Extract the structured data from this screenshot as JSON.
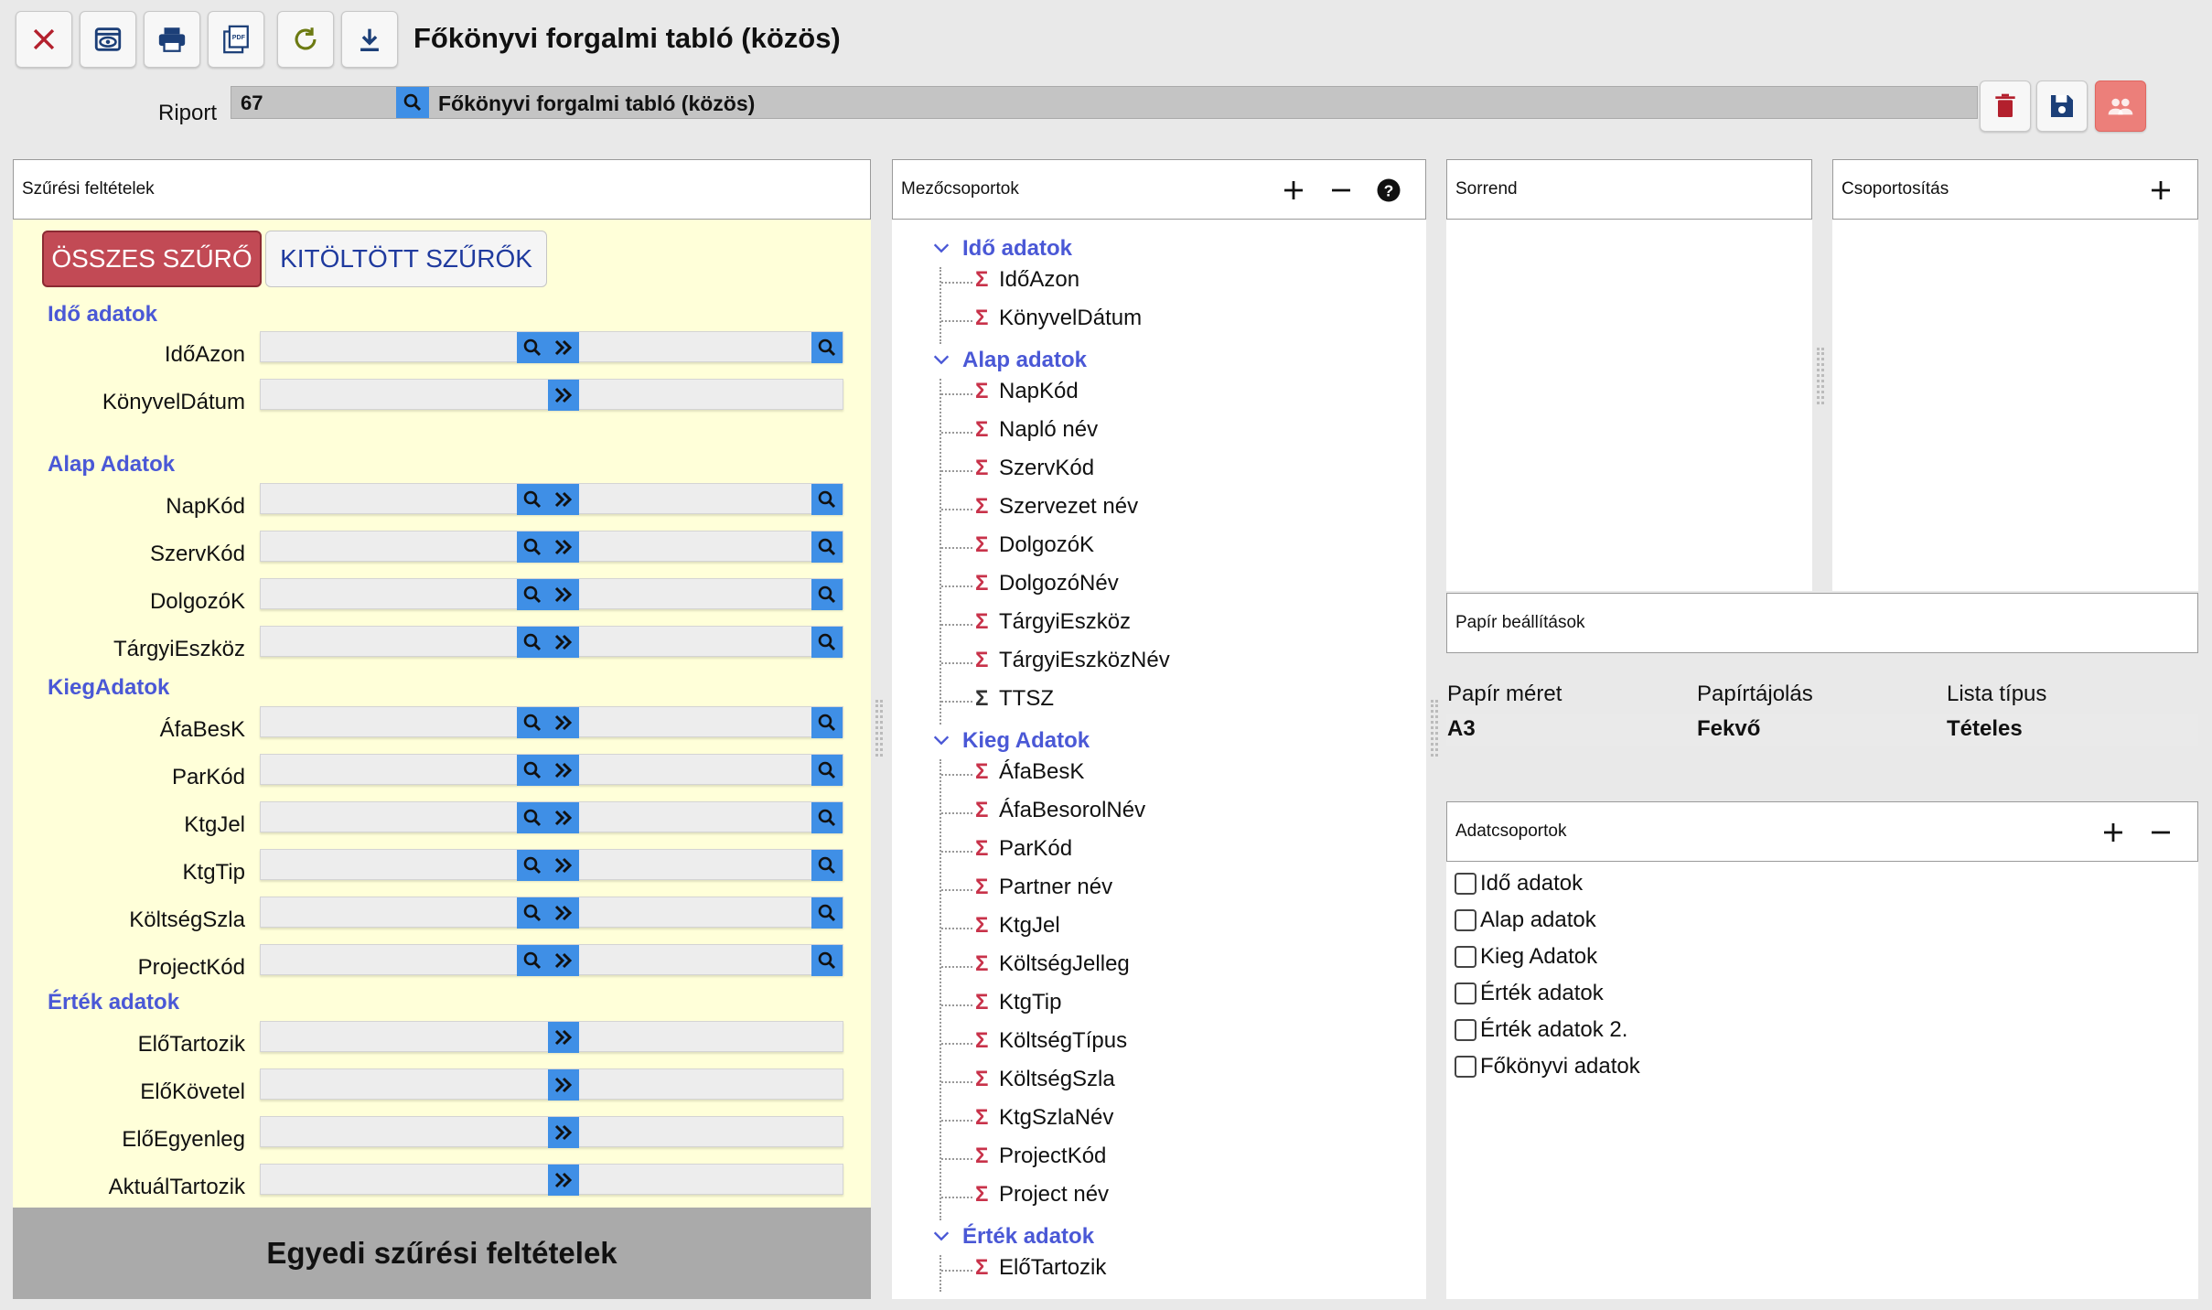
{
  "window": {
    "title": "Főkönyvi forgalmi tabló (közös)"
  },
  "colors": {
    "accent": "#3f8fe6",
    "group_text": "#4a58d6",
    "filter_bg": "#ffffd9",
    "active_tab": "#c24a55",
    "sigma_red": "#c8324a"
  },
  "toolbar": {
    "icons": [
      "close-icon",
      "preview-icon",
      "print-icon",
      "pdf-icon",
      "refresh-icon",
      "download-icon"
    ]
  },
  "report": {
    "label": "Riport",
    "id": "67",
    "name": "Főkönyvi forgalmi tabló (közös)"
  },
  "filters": {
    "title": "Szűrési feltételek",
    "tab_all": "ÖSSZES SZŰRŐ",
    "tab_filled": "KITÖLTÖTT SZŰRŐK",
    "custom": "Egyedi szűrési feltételek",
    "groups": [
      {
        "name": "Idő adatok",
        "fields": [
          {
            "label": "IdőAzon",
            "type": "range"
          },
          {
            "label": "KönyvelDátum",
            "type": "date"
          }
        ]
      },
      {
        "name": "Alap Adatok",
        "fields": [
          {
            "label": "NapKód",
            "type": "range"
          },
          {
            "label": "SzervKód",
            "type": "range"
          },
          {
            "label": "DolgozóK",
            "type": "range"
          },
          {
            "label": "TárgyiEszköz",
            "type": "range"
          }
        ]
      },
      {
        "name": "KiegAdatok",
        "fields": [
          {
            "label": "ÁfaBesK",
            "type": "range"
          },
          {
            "label": "ParKód",
            "type": "range"
          },
          {
            "label": "KtgJel",
            "type": "range"
          },
          {
            "label": "KtgTip",
            "type": "range"
          },
          {
            "label": "KöltségSzla",
            "type": "range"
          },
          {
            "label": "ProjectKód",
            "type": "range"
          }
        ]
      },
      {
        "name": "Érték adatok",
        "fields": [
          {
            "label": "ElőTartozik",
            "type": "date"
          },
          {
            "label": "ElőKövetel",
            "type": "date"
          },
          {
            "label": "ElőEgyenleg",
            "type": "date"
          },
          {
            "label": "AktuálTartozik",
            "type": "date"
          }
        ]
      }
    ]
  },
  "fieldgroups": {
    "title": "Mezőcsoportok",
    "groups": [
      {
        "name": "Idő adatok",
        "items": [
          "IdőAzon",
          "KönyvelDátum"
        ]
      },
      {
        "name": "Alap adatok",
        "items": [
          "NapKód",
          "Napló név",
          "SzervKód",
          "Szervezet név",
          "DolgozóK",
          "DolgozóNév",
          "TárgyiEszköz",
          "TárgyiEszközNév",
          "TTSZ"
        ]
      },
      {
        "name": "Kieg Adatok",
        "items": [
          "ÁfaBesK",
          "ÁfaBesorolNév",
          "ParKód",
          "Partner név",
          "KtgJel",
          "KöltségJelleg",
          "KtgTip",
          "KöltségTípus",
          "KöltségSzla",
          "KtgSzlaNév",
          "ProjectKód",
          "Project név"
        ]
      },
      {
        "name": "Érték adatok",
        "items": [
          "ElőTartozik"
        ]
      }
    ]
  },
  "order": {
    "title": "Sorrend"
  },
  "grouping": {
    "title": "Csoportosítás"
  },
  "paper": {
    "title": "Papír beállítások",
    "headers": [
      "Papír méret",
      "Papírtájolás",
      "Lista típus"
    ],
    "values": [
      "A3",
      "Fekvő",
      "Tételes"
    ]
  },
  "datagroups": {
    "title": "Adatcsoportok",
    "items": [
      "Idő adatok",
      "Alap adatok",
      "Kieg Adatok",
      "Érték adatok",
      "Érték adatok 2.",
      "Főkönyvi adatok"
    ]
  }
}
